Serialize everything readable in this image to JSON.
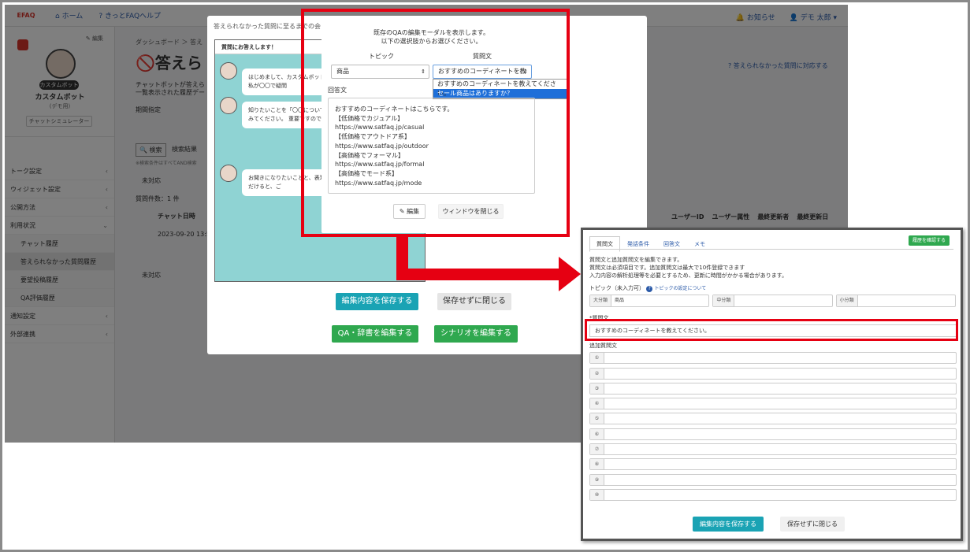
{
  "topnav": {
    "logo": "EFAQ",
    "home": "ホーム",
    "help": "きっとFAQヘルプ",
    "notices": "お知らせ",
    "user": "デモ 太郎"
  },
  "sidebar": {
    "edit": "編集",
    "bot_badge": "カスタムボット",
    "bot_name": "カスタムボット",
    "bot_sub": "(デモ用)",
    "emulator": "チャットシミュレーター",
    "items": [
      {
        "label": "トーク設定"
      },
      {
        "label": "ウィジェット設定"
      },
      {
        "label": "公開方法"
      },
      {
        "label": "利用状況"
      }
    ],
    "subitems": [
      {
        "label": "チャット履歴"
      },
      {
        "label": "答えられなかった質問履歴"
      },
      {
        "label": "要望投稿履歴"
      },
      {
        "label": "QA評価履歴"
      }
    ],
    "items2": [
      {
        "label": "通知設定"
      },
      {
        "label": "外部連携"
      }
    ]
  },
  "background": {
    "breadcrumb": "ダッシュボード ＞ 答え",
    "page_title": "答えら",
    "desc1": "チャットボットが答えら",
    "desc2": "一覧表示された履歴デー",
    "period": "期間指定",
    "search": "検索",
    "search_result": "検索結果",
    "filter_note": "※検索条件はすべてAND検索",
    "unanswered": "未対応",
    "count": "質問件数：1 件",
    "col_date": "チャット日時",
    "row_date": "2023-09-20 13:5",
    "unanswered2": "未対応",
    "cols": [
      "ユーザーID",
      "ユーザー属性",
      "最終更新者",
      "最終更新日"
    ],
    "handle_link": "答えられなかった質問に対応する"
  },
  "back_dialog": {
    "title": "答えられなかった質問に至るまでの会",
    "chat_header": "質問にお答えします！",
    "bubbles": [
      "はじめまして、カスタムボットです。QAロボットの私が〇〇で疑問",
      "知りたいことを「〇〇について」のように入力してみてください。 重要ですので気軽に聞いてください",
      "お聞きになりたいことと、表現の仕方を変えていただけると、ご"
    ],
    "save": "編集内容を保存する",
    "close": "保存せずに閉じる",
    "edit_qa": "QA・辞書を編集する",
    "edit_scenario": "シナリオを編集する"
  },
  "front_modal": {
    "message_line1": "既存のQAの編集モーダルを表示します。",
    "message_line2": "以下の選択肢からお選びください。",
    "topic_label": "トピック",
    "question_label": "質問文",
    "topic_value": "商品",
    "question_value": "おすすめのコーディネートを教",
    "options": [
      "おすすめのコーディネートを教えてください。",
      "セール商品はありますか？"
    ],
    "answer_label": "回答文",
    "answer_lines": [
      "おすすめのコーディネートはこちらです。",
      "【低価格でカジュアル】",
      "https://www.satfaq.jp/casual",
      "【低価格でアウトドア系】",
      "https://www.satfaq.jp/outdoor",
      "【高価格でフォーマル】",
      "https://www.satfaq.jp/formal",
      "【高価格でモード系】",
      "https://www.satfaq.jp/mode"
    ],
    "edit_button": "編集",
    "close_button": "ウィンドウを閉じる"
  },
  "inset": {
    "tabs": [
      "質問文",
      "発話条件",
      "回答文",
      "メモ"
    ],
    "history_button": "履歴を確認する",
    "desc": [
      "質問文と追加質問文を編集できます。",
      "質問文は必須項目です。追加質問文は最大で10件登録できます",
      "入力内容の解析処理等を必要とするため、更新に時間がかかる場合があります。"
    ],
    "topic_label": "トピック（未入力可）",
    "topic_help": "トピックの設定について",
    "topic_cells": [
      {
        "label": "大分類",
        "value": "商品"
      },
      {
        "label": "中分類",
        "value": ""
      },
      {
        "label": "小分類",
        "value": ""
      }
    ],
    "question_label": "*質問文",
    "question_value": "おすすめのコーディネートを教えてください。",
    "additional_label": "追加質問文",
    "additional_nums": [
      "①",
      "②",
      "③",
      "④",
      "⑤",
      "⑥",
      "⑦",
      "⑧",
      "⑨",
      "⑩"
    ],
    "save": "編集内容を保存する",
    "close": "保存せずに閉じる"
  },
  "colors": {
    "highlight": "#e60012",
    "teal": "#1aa3b4",
    "green": "#2fa84f",
    "chat_bg": "#8fd3d3"
  }
}
